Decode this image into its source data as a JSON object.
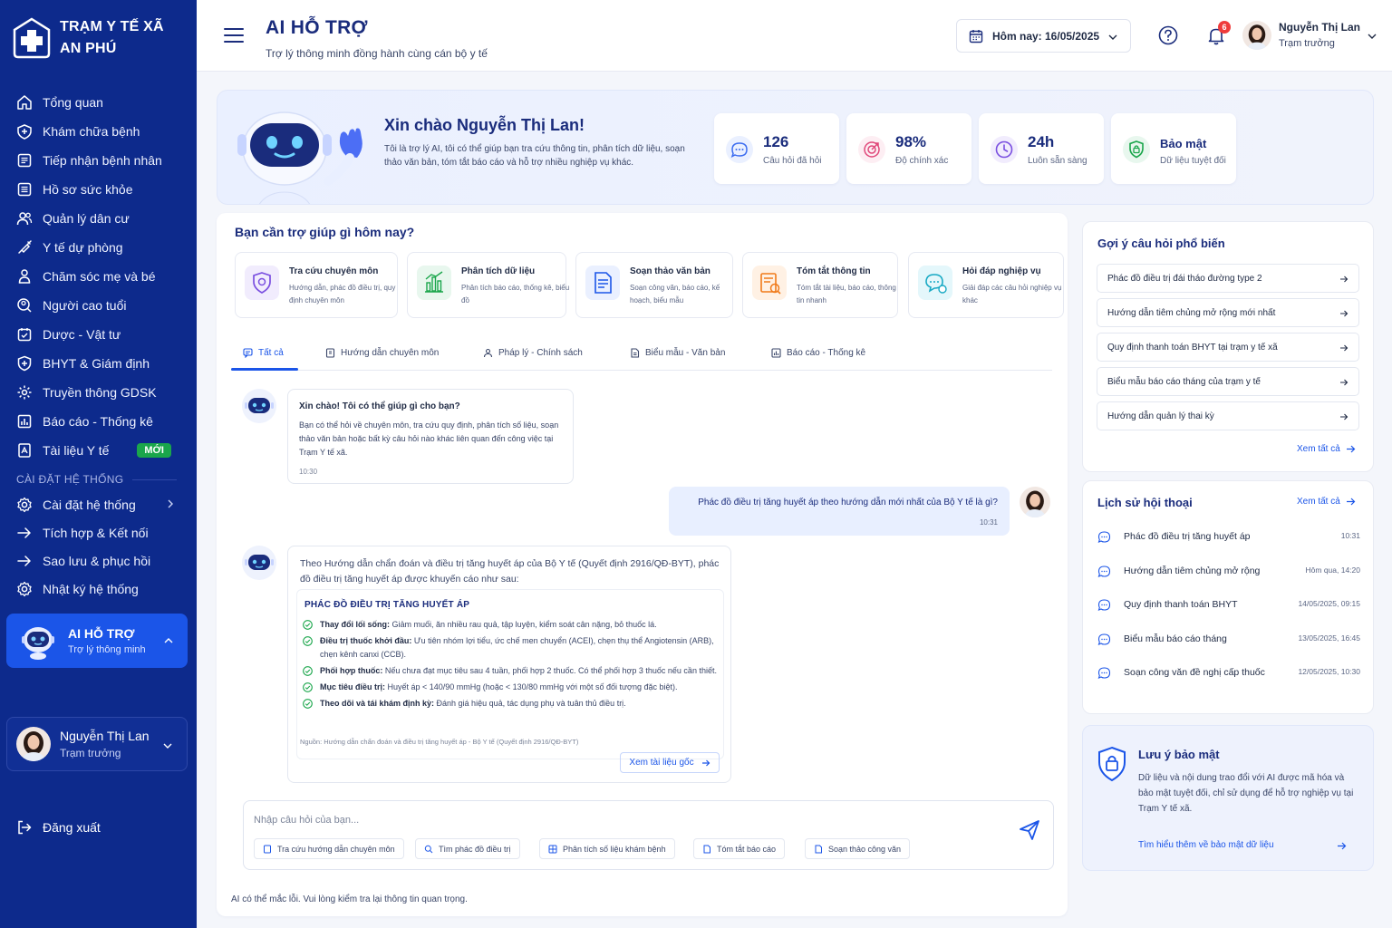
{
  "sidebar": {
    "brand_line1": "TRẠM Y TẾ XÃ",
    "brand_line2": "AN PHÚ",
    "items": [
      {
        "label": "Tổng quan",
        "icon": "home-icon"
      },
      {
        "label": "Khám chữa bệnh",
        "icon": "stethoscope-icon"
      },
      {
        "label": "Tiếp nhận bệnh nhân",
        "icon": "clipboard-icon"
      },
      {
        "label": "Hồ sơ sức khỏe",
        "icon": "folder-icon"
      },
      {
        "label": "Quản lý dân cư",
        "icon": "users-icon"
      },
      {
        "label": "Y tế dự phòng",
        "icon": "syringe-icon"
      },
      {
        "label": "Chăm sóc mẹ và bé",
        "icon": "mother-icon"
      },
      {
        "label": "Người cao tuổi",
        "icon": "elderly-icon"
      },
      {
        "label": "Dược - Vật tư",
        "icon": "pill-icon"
      },
      {
        "label": "BHYT & Giám định",
        "icon": "shield-icon"
      },
      {
        "label": "Truyền thông GDSK",
        "icon": "megaphone-icon"
      },
      {
        "label": "Báo cáo - Thống kê",
        "icon": "chart-icon"
      },
      {
        "label": "Tài liệu Y tế",
        "icon": "document-icon",
        "badge": "MỚI"
      }
    ],
    "section_label": "CÀI ĐẶT HỆ THỐNG",
    "settings_items": [
      {
        "label": "Cài đặt hệ thống",
        "icon": "gear-icon"
      },
      {
        "label": "Tích hợp & Kết nối",
        "icon": "link-icon"
      },
      {
        "label": "Sao lưu & phục hồi",
        "icon": "backup-icon"
      },
      {
        "label": "Nhật ký hệ thống",
        "icon": "log-icon"
      }
    ],
    "ai_card": {
      "title": "AI HỖ TRỢ",
      "subtitle": "Trợ lý thông minh"
    },
    "user": {
      "name": "Nguyễn Thị Lan",
      "role": "Trạm trưởng"
    },
    "logout_label": "Đăng xuất"
  },
  "header": {
    "title": "AI HỖ TRỢ",
    "subtitle": "Trợ lý thông minh đồng hành cùng cán bộ y tế",
    "date_label": "Hôm nay: 16/05/2025",
    "notification_count": "6",
    "user_name": "Nguyễn Thị Lan",
    "user_role": "Trạm trưởng"
  },
  "banner": {
    "greeting": "Xin chào Nguyễn Thị Lan!",
    "description": "Tôi là trợ lý AI, tôi có thể giúp bạn tra cứu thông tin, phân tích dữ liệu, soạn thảo văn bản, tóm tắt báo cáo và hỗ trợ nhiều nghiệp vụ khác.",
    "stats": [
      {
        "value": "126",
        "label": "Câu hỏi đã hỏi",
        "icon": "chat-icon",
        "color": "#3b6cf0"
      },
      {
        "value": "98%",
        "label": "Độ chính xác",
        "icon": "target-icon",
        "color": "#e0487a"
      },
      {
        "value": "24h",
        "label": "Luôn sẵn sàng",
        "icon": "clock-icon",
        "color": "#7a4fe0"
      },
      {
        "value": "Bảo mật",
        "label": "Dữ liệu tuyệt đối",
        "icon": "shield-check-icon",
        "color": "#1aa64b"
      }
    ]
  },
  "main": {
    "title": "Bạn cần trợ giúp gì hôm nay?",
    "categories": [
      {
        "title": "Tra cứu chuyên môn",
        "desc": "Hướng dẫn, phác đồ điều trị, quy định chuyên môn",
        "icon": "shield-search-icon",
        "color": "#7a4fe0"
      },
      {
        "title": "Phân tích dữ liệu",
        "desc": "Phân tích báo cáo, thống kê, biểu đồ",
        "icon": "bar-chart-icon",
        "color": "#1aa64b"
      },
      {
        "title": "Soạn thảo văn bản",
        "desc": "Soạn công văn, báo cáo, kế hoạch, biểu mẫu",
        "icon": "file-edit-icon",
        "color": "#1b55e8"
      },
      {
        "title": "Tóm tắt thông tin",
        "desc": "Tóm tắt tài liệu, báo cáo, thông tin nhanh",
        "icon": "summary-icon",
        "color": "#f07a1a"
      },
      {
        "title": "Hỏi đáp nghiệp vụ",
        "desc": "Giải đáp các câu hỏi nghiệp vụ khác",
        "icon": "qa-icon",
        "color": "#17a9c4"
      }
    ],
    "tabs": [
      {
        "label": "Tất cả",
        "icon": "chat-icon"
      },
      {
        "label": "Hướng dẫn chuyên môn",
        "icon": "book-icon"
      },
      {
        "label": "Pháp lý - Chính sách",
        "icon": "scale-icon"
      },
      {
        "label": "Biểu mẫu - Văn bản",
        "icon": "form-icon"
      },
      {
        "label": "Báo cáo - Thống kê",
        "icon": "report-icon"
      }
    ],
    "chat": {
      "welcome_title": "Xin chào! Tôi có thể giúp gì cho bạn?",
      "welcome_body": "Bạn có thể hỏi về chuyên môn, tra cứu quy định, phân tích số liệu, soạn thảo văn bản hoặc bất kỳ câu hỏi nào khác liên quan đến công việc tại Trạm Y tế xã.",
      "welcome_time": "10:30",
      "user_question": "Phác đồ điều trị tăng huyết áp theo hướng dẫn mới nhất của Bộ Y tế là gì?",
      "user_time": "10:31",
      "answer_intro": "Theo Hướng dẫn chẩn đoán và điều trị tăng huyết áp của Bộ Y tế (Quyết định 2916/QĐ-BYT), phác đồ điều trị tăng huyết áp được khuyến cáo như sau:",
      "answer_heading": "PHÁC ĐỒ ĐIỀU TRỊ TĂNG HUYẾT ÁP",
      "answer_points": [
        {
          "label": "Thay đổi lối sống:",
          "text": " Giảm muối, ăn nhiều rau quả, tập luyện, kiểm soát cân nặng, bỏ thuốc lá."
        },
        {
          "label": "Điều trị thuốc khởi đầu:",
          "text": " Ưu tiên nhóm lợi tiểu, ức chế men chuyển (ACEI), chẹn thụ thể Angiotensin (ARB), chẹn kênh canxi (CCB)."
        },
        {
          "label": "Phối hợp thuốc:",
          "text": " Nếu chưa đạt mục tiêu sau 4 tuần, phối hợp 2 thuốc. Có thể phối hợp 3 thuốc nếu cần thiết."
        },
        {
          "label": "Mục tiêu điều trị:",
          "text": " Huyết áp < 140/90 mmHg (hoặc < 130/80 mmHg với một số đối tượng đặc biệt)."
        },
        {
          "label": "Theo dõi và tái khám định kỳ:",
          "text": " Đánh giá hiệu quả, tác dụng phụ và tuân thủ điều trị."
        }
      ],
      "answer_source": "Nguồn: Hướng dẫn chẩn đoán và điều trị tăng huyết áp - Bộ Y tế (Quyết định 2916/QĐ-BYT)",
      "view_source_label": "Xem tài liệu gốc"
    },
    "input_placeholder": "Nhập câu hỏi của bạn...",
    "quick_chips": [
      {
        "label": "Tra cứu hướng dẫn chuyên môn",
        "icon": "book-icon"
      },
      {
        "label": "Tìm phác đồ điều trị",
        "icon": "search-icon"
      },
      {
        "label": "Phân tích số liệu khám bệnh",
        "icon": "grid-icon"
      },
      {
        "label": "Tóm tắt báo cáo",
        "icon": "doc-icon"
      },
      {
        "label": "Soạn thảo công văn",
        "icon": "doc-icon"
      }
    ],
    "disclaimer": "AI có thể mắc lỗi. Vui lòng kiểm tra lại thông tin quan trọng."
  },
  "suggestions": {
    "title": "Gợi ý câu hỏi phổ biến",
    "items": [
      "Phác đồ điều trị đái tháo đường type 2",
      "Hướng dẫn tiêm chủng mở rộng mới nhất",
      "Quy định thanh toán BHYT tại trạm y tế xã",
      "Biểu mẫu báo cáo tháng của trạm y tế",
      "Hướng dẫn quản lý thai kỳ"
    ],
    "see_all": "Xem tất cả"
  },
  "history": {
    "title": "Lịch sử hội thoại",
    "see_all": "Xem tất cả",
    "items": [
      {
        "text": "Phác đồ điều trị tăng huyết áp",
        "time": "10:31"
      },
      {
        "text": "Hướng dẫn tiêm chủng mở rộng",
        "time": "Hôm qua, 14:20"
      },
      {
        "text": "Quy định thanh toán BHYT",
        "time": "14/05/2025, 09:15"
      },
      {
        "text": "Biểu mẫu báo cáo tháng",
        "time": "13/05/2025, 16:45"
      },
      {
        "text": "Soạn công văn đề nghị cấp thuốc",
        "time": "12/05/2025, 10:30"
      }
    ]
  },
  "security": {
    "title": "Lưu ý bảo mật",
    "body": "Dữ liệu và nội dung trao đổi với AI được mã hóa và bảo mật tuyệt đối, chỉ sử dụng để hỗ trợ nghiệp vụ tại Trạm Y tế xã.",
    "link": "Tìm hiểu thêm về bảo mật dữ liệu"
  }
}
